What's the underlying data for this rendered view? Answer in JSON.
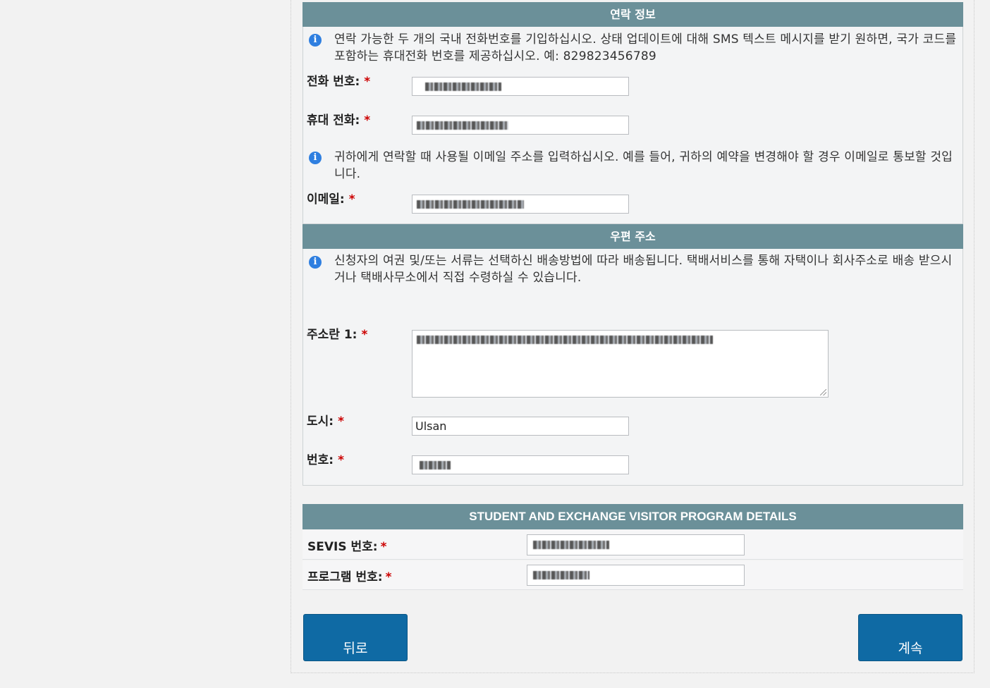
{
  "contact": {
    "title": "연락 정보",
    "phone_info": "연락 가능한 두 개의 국내 전화번호를 기입하십시오. 상태 업데이트에 대해 SMS 텍스트 메시지를 받기 원하면, 국가 코드를 포함하는 휴대전화 번호를 제공하십시오. 예: 829823456789",
    "phone_label": "전화 번호:",
    "mobile_label": "휴대 전화:",
    "email_info": "귀하에게 연락할 때 사용될 이메일 주소를 입력하십시오. 예를 들어, 귀하의 예약을 변경해야 할 경우 이메일로 통보할 것입니다.",
    "email_label": "이메일:",
    "required_mark": "*"
  },
  "mailing": {
    "title": "우편 주소",
    "info": "신청자의 여권 및/또는 서류는 선택하신 배송방법에 따라 배송됩니다.  택배서비스를 통해 자택이나 회사주소로 배송 받으시거나 택배사무소에서 직접 수령하실 수 있습니다.",
    "address1_label": "주소란 1:",
    "city_label": "도시:",
    "city_value": "Ulsan",
    "postal_label": "번호:"
  },
  "sevis": {
    "title": "STUDENT AND EXCHANGE VISITOR PROGRAM DETAILS",
    "sevis_label": "SEVIS 번호:",
    "program_label": "프로그램 번호:"
  },
  "buttons": {
    "back": "뒤로",
    "continue": "계속"
  },
  "icons": {
    "info": "info-icon"
  },
  "colors": {
    "header_bar": "#6b9099",
    "button": "#0f6aa4",
    "info_icon": "#2f7fe0",
    "required": "#cc0000"
  }
}
